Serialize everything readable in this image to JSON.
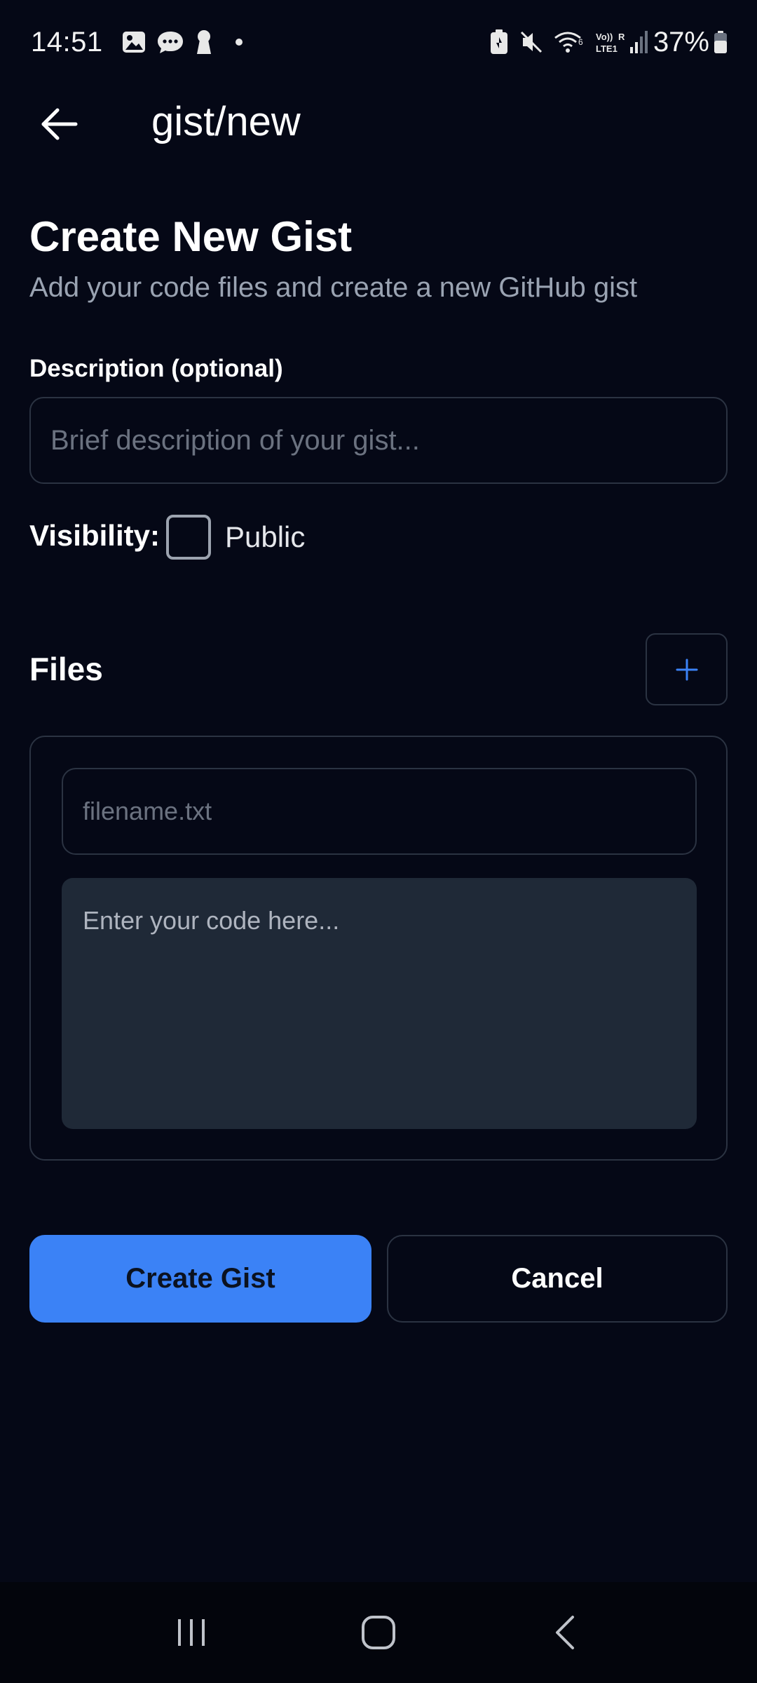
{
  "status_bar": {
    "time": "14:51",
    "battery": "37%",
    "left_icons": [
      "gallery-icon",
      "chat-icon",
      "keyhole-icon",
      "dot-icon"
    ],
    "right_icons": [
      "battery-saver-icon",
      "mute-icon",
      "wifi-icon",
      "volte-icon",
      "signal-icon",
      "battery-icon"
    ]
  },
  "app_bar": {
    "title": "gist/new",
    "back_icon": "arrow-left-icon"
  },
  "header": {
    "title": "Create New Gist",
    "subtitle": "Add your code files and create a new GitHub gist"
  },
  "description": {
    "label": "Description (optional)",
    "placeholder": "Brief description of your gist...",
    "value": ""
  },
  "visibility": {
    "label": "Visibility:",
    "option_label": "Public",
    "checked": false
  },
  "files": {
    "heading": "Files",
    "add_icon": "plus-icon",
    "items": [
      {
        "filename_placeholder": "filename.txt",
        "filename_value": "",
        "code_placeholder": "Enter your code here...",
        "code_value": ""
      }
    ]
  },
  "actions": {
    "create_label": "Create Gist",
    "cancel_label": "Cancel"
  },
  "colors": {
    "background": "#050816",
    "accent": "#3b82f6",
    "border": "#2b3342",
    "code_area": "#1f2937",
    "muted_text": "#9aa3b2"
  },
  "nav_bar": {
    "icons": [
      "recents-icon",
      "home-icon",
      "back-icon"
    ]
  }
}
